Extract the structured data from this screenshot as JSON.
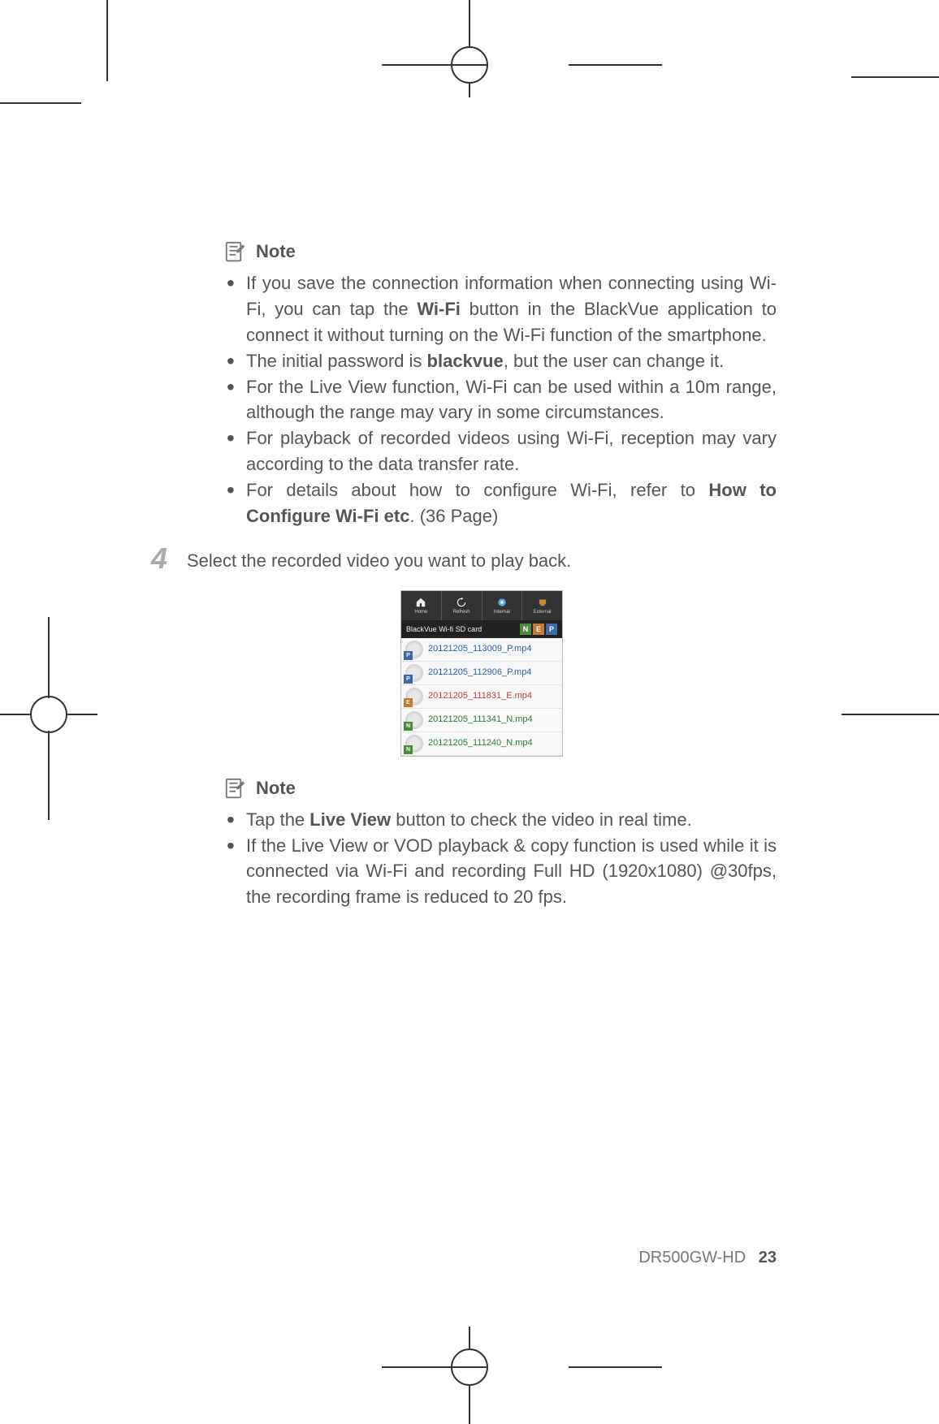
{
  "note1": {
    "label": "Note",
    "items": [
      {
        "pre": "If you save the connection information when connecting using Wi-Fi, you can tap the ",
        "bold": "Wi-Fi",
        "post": " button in the BlackVue application to connect it without turning on the Wi-Fi function of the smartphone."
      },
      {
        "pre": "The initial password is ",
        "bold": "blackvue",
        "post": ", but the user can change it."
      },
      {
        "text": "For the Live View function, Wi-Fi can be used within a 10m range, although the range may vary in some circumstances."
      },
      {
        "text": "For playback of recorded videos using Wi-Fi, reception may vary according to the data transfer rate."
      },
      {
        "pre": "For details about how to configure Wi-Fi, refer to ",
        "bold": "How to Configure Wi-Fi etc",
        "post": ". (36 Page)"
      }
    ]
  },
  "step": {
    "num": "4",
    "text": "Select the recorded video you want to play back."
  },
  "app": {
    "topButtons": [
      {
        "name": "home",
        "label": "Home"
      },
      {
        "name": "refresh",
        "label": "Refresh"
      },
      {
        "name": "internal",
        "label": "Internal"
      },
      {
        "name": "external",
        "label": "External"
      }
    ],
    "title": "BlackVue Wi-fi SD card",
    "badges": [
      "N",
      "E",
      "P"
    ],
    "files": [
      {
        "name": "20121205_113009_P.mp4",
        "cls": "fn-blue",
        "badge": "P",
        "bcls": "badge-p"
      },
      {
        "name": "20121205_112906_P.mp4",
        "cls": "fn-blue",
        "badge": "P",
        "bcls": "badge-p"
      },
      {
        "name": "20121205_111831_E.mp4",
        "cls": "fn-red",
        "badge": "E",
        "bcls": "badge-ef"
      },
      {
        "name": "20121205_111341_N.mp4",
        "cls": "fn-green",
        "badge": "N",
        "bcls": "badge-nf"
      },
      {
        "name": "20121205_111240_N.mp4",
        "cls": "fn-green",
        "badge": "N",
        "bcls": "badge-nf"
      }
    ]
  },
  "note2": {
    "label": "Note",
    "items": [
      {
        "pre": "Tap the ",
        "bold": "Live View",
        "post": " button to check the video in real time."
      },
      {
        "text": "If the Live View or VOD playback & copy function is used while it is connected via Wi-Fi and recording Full HD (1920x1080) @30fps, the recording frame is reduced to 20 fps."
      }
    ]
  },
  "footer": {
    "model": "DR500GW-HD",
    "page": "23"
  }
}
